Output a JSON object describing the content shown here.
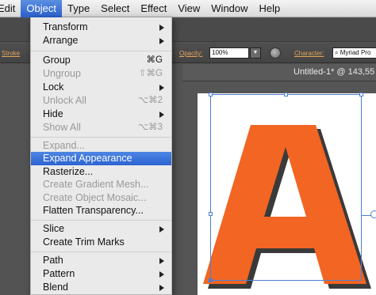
{
  "menubar": {
    "items": [
      {
        "label": "Edit",
        "active": false
      },
      {
        "label": "Object",
        "active": true
      },
      {
        "label": "Type",
        "active": false
      },
      {
        "label": "Select",
        "active": false
      },
      {
        "label": "Effect",
        "active": false
      },
      {
        "label": "View",
        "active": false
      },
      {
        "label": "Window",
        "active": false
      },
      {
        "label": "Help",
        "active": false
      }
    ]
  },
  "control_bar": {
    "stroke_label": "Stroke",
    "opacity_label": "Opacity:",
    "opacity_value": "100%",
    "character_label": "Character:",
    "font_value": "Myriad Pro"
  },
  "document": {
    "tab_title": "Untitled-1* @ 143,55"
  },
  "artwork": {
    "glyph": "A",
    "fill_color": "#f26522",
    "shadow_color": "#3a3a3a"
  },
  "object_menu": {
    "items": [
      {
        "label": "Transform",
        "shortcut": "",
        "submenu": true,
        "disabled": false,
        "highlighted": false
      },
      {
        "label": "Arrange",
        "shortcut": "",
        "submenu": true,
        "disabled": false,
        "highlighted": false
      },
      {
        "label": "Group",
        "shortcut": "⌘G",
        "submenu": false,
        "disabled": false,
        "highlighted": false
      },
      {
        "label": "Ungroup",
        "shortcut": "⇧⌘G",
        "submenu": false,
        "disabled": true,
        "highlighted": false
      },
      {
        "label": "Lock",
        "shortcut": "",
        "submenu": true,
        "disabled": false,
        "highlighted": false
      },
      {
        "label": "Unlock All",
        "shortcut": "⌥⌘2",
        "submenu": false,
        "disabled": true,
        "highlighted": false
      },
      {
        "label": "Hide",
        "shortcut": "",
        "submenu": true,
        "disabled": false,
        "highlighted": false
      },
      {
        "label": "Show All",
        "shortcut": "⌥⌘3",
        "submenu": false,
        "disabled": true,
        "highlighted": false
      },
      {
        "label": "Expand...",
        "shortcut": "",
        "submenu": false,
        "disabled": true,
        "highlighted": false
      },
      {
        "label": "Expand Appearance",
        "shortcut": "",
        "submenu": false,
        "disabled": false,
        "highlighted": true
      },
      {
        "label": "Rasterize...",
        "shortcut": "",
        "submenu": false,
        "disabled": false,
        "highlighted": false
      },
      {
        "label": "Create Gradient Mesh...",
        "shortcut": "",
        "submenu": false,
        "disabled": true,
        "highlighted": false
      },
      {
        "label": "Create Object Mosaic...",
        "shortcut": "",
        "submenu": false,
        "disabled": true,
        "highlighted": false
      },
      {
        "label": "Flatten Transparency...",
        "shortcut": "",
        "submenu": false,
        "disabled": false,
        "highlighted": false
      },
      {
        "label": "Slice",
        "shortcut": "",
        "submenu": true,
        "disabled": false,
        "highlighted": false
      },
      {
        "label": "Create Trim Marks",
        "shortcut": "",
        "submenu": false,
        "disabled": false,
        "highlighted": false
      },
      {
        "label": "Path",
        "shortcut": "",
        "submenu": true,
        "disabled": false,
        "highlighted": false
      },
      {
        "label": "Pattern",
        "shortcut": "",
        "submenu": true,
        "disabled": false,
        "highlighted": false
      },
      {
        "label": "Blend",
        "shortcut": "",
        "submenu": true,
        "disabled": false,
        "highlighted": false
      }
    ]
  }
}
